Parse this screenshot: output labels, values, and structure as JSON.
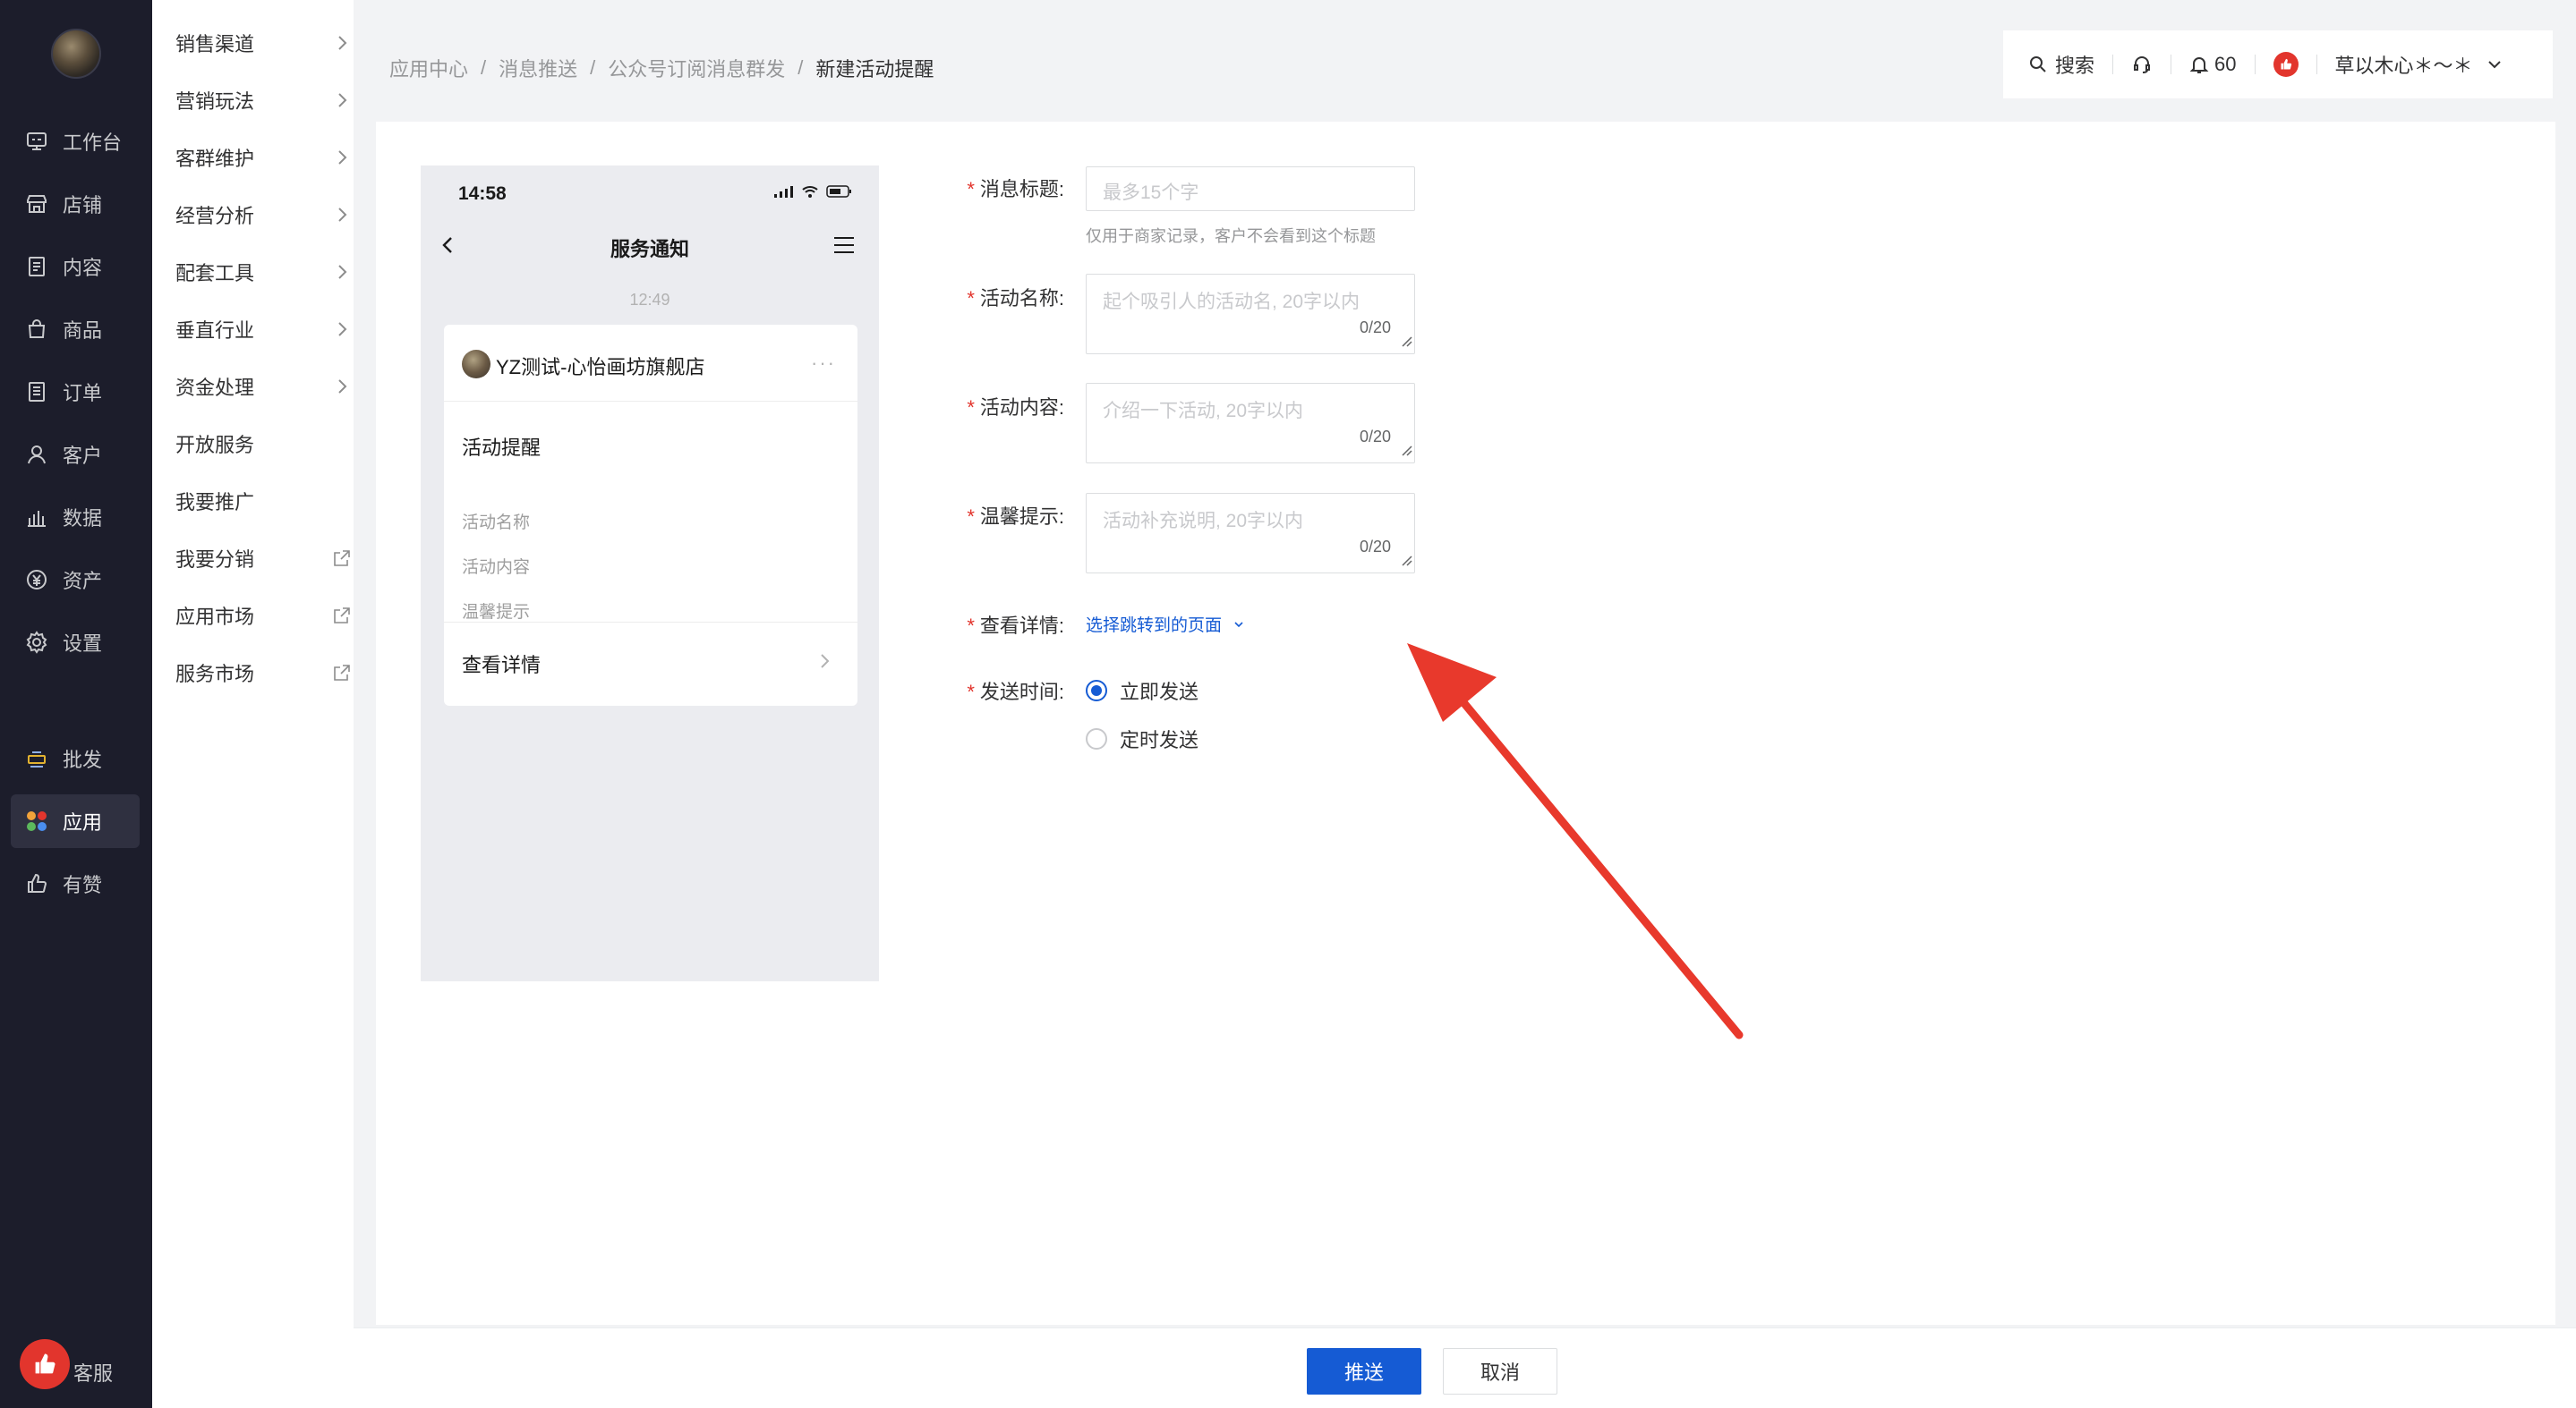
{
  "nav": {
    "items": [
      {
        "label": "工作台",
        "icon": "workbench-icon"
      },
      {
        "label": "店铺",
        "icon": "store-icon"
      },
      {
        "label": "内容",
        "icon": "content-icon"
      },
      {
        "label": "商品",
        "icon": "goods-icon"
      },
      {
        "label": "订单",
        "icon": "order-icon"
      },
      {
        "label": "客户",
        "icon": "customer-icon"
      },
      {
        "label": "数据",
        "icon": "data-icon"
      },
      {
        "label": "资产",
        "icon": "asset-icon"
      },
      {
        "label": "设置",
        "icon": "settings-icon"
      },
      {
        "label": "批发",
        "icon": "wholesale-icon"
      },
      {
        "label": "应用",
        "icon": "apps-icon"
      },
      {
        "label": "有赞",
        "icon": "thumbs-up-icon"
      }
    ],
    "service_label": "客服"
  },
  "submenu": {
    "items": [
      {
        "label": "销售渠道",
        "type": "chevron"
      },
      {
        "label": "营销玩法",
        "type": "chevron"
      },
      {
        "label": "客群维护",
        "type": "chevron"
      },
      {
        "label": "经营分析",
        "type": "chevron"
      },
      {
        "label": "配套工具",
        "type": "chevron"
      },
      {
        "label": "垂直行业",
        "type": "chevron"
      },
      {
        "label": "资金处理",
        "type": "chevron"
      },
      {
        "label": "开放服务",
        "type": "none"
      },
      {
        "label": "我要推广",
        "type": "none"
      },
      {
        "label": "我要分销",
        "type": "external"
      },
      {
        "label": "应用市场",
        "type": "external"
      },
      {
        "label": "服务市场",
        "type": "external"
      }
    ]
  },
  "breadcrumb": {
    "items": [
      "应用中心",
      "消息推送",
      "公众号订阅消息群发"
    ],
    "current": "新建活动提醒",
    "separator": "/"
  },
  "topbar": {
    "search_label": "搜索",
    "notification_count": "60",
    "username": "草以木心＊～＊"
  },
  "phone": {
    "time": "14:58",
    "title": "服务通知",
    "timestamp": "12:49",
    "shop_name": "YZ测试-心怡画坊旗舰店",
    "more": "···",
    "message_title": "活动提醒",
    "fields": [
      "活动名称",
      "活动内容",
      "温馨提示"
    ],
    "detail_label": "查看详情"
  },
  "form": {
    "message_title": {
      "label": "消息标题:",
      "placeholder": "最多15个字",
      "hint": "仅用于商家记录，客户不会看到这个标题"
    },
    "activity_name": {
      "label": "活动名称:",
      "placeholder": "起个吸引人的活动名, 20字以内",
      "count": "0/20"
    },
    "activity_content": {
      "label": "活动内容:",
      "placeholder": "介绍一下活动, 20字以内",
      "count": "0/20"
    },
    "tips": {
      "label": "温馨提示:",
      "placeholder": "活动补充说明, 20字以内",
      "count": "0/20"
    },
    "detail": {
      "label": "查看详情:",
      "link": "选择跳转到的页面"
    },
    "send_time": {
      "label": "发送时间:",
      "options": [
        "立即发送",
        "定时发送"
      ],
      "selected": "立即发送"
    },
    "required_mark": "*"
  },
  "actions": {
    "submit": "推送",
    "cancel": "取消"
  },
  "colors": {
    "primary": "#155bd4",
    "nav_bg": "#1c1d2b",
    "required": "#e2352d",
    "annotation_arrow": "#e8392c"
  }
}
